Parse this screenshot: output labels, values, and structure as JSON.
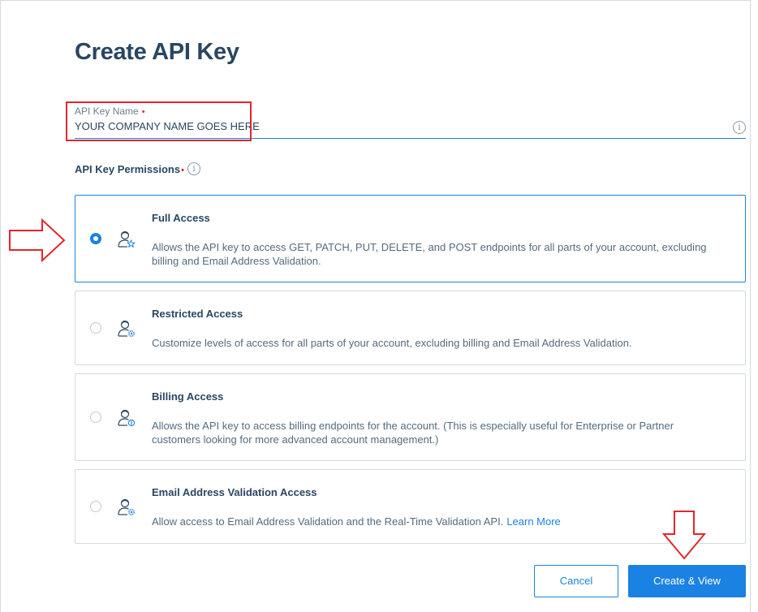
{
  "page": {
    "title": "Create API Key"
  },
  "name_field": {
    "label": "API Key Name",
    "required_mark": "•",
    "value": "YOUR COMPANY NAME GOES HERE",
    "info_glyph": "i"
  },
  "permissions": {
    "label": "API Key Permissions",
    "required_mark": "•",
    "info_glyph": "i",
    "selected": "full",
    "options": [
      {
        "id": "full",
        "title": "Full Access",
        "description": "Allows the API key to access GET, PATCH, PUT, DELETE, and POST endpoints for all parts of your account, excluding billing and Email Address Validation.",
        "icon": "user-star-icon",
        "checked": true
      },
      {
        "id": "restricted",
        "title": "Restricted Access",
        "description": "Customize levels of access for all parts of your account, excluding billing and Email Address Validation.",
        "icon": "user-gear-icon",
        "checked": false
      },
      {
        "id": "billing",
        "title": "Billing Access",
        "description": "Allows the API key to access billing endpoints for the account. (This is especially useful for Enterprise or Partner customers looking for more advanced account management.)",
        "icon": "user-dollar-icon",
        "checked": false
      },
      {
        "id": "email_validation",
        "title": "Email Address Validation Access",
        "description": "Allow access to Email Address Validation and the Real-Time Validation API.",
        "link": "Learn More",
        "icon": "user-gear-icon",
        "checked": false
      }
    ]
  },
  "buttons": {
    "cancel": "Cancel",
    "create": "Create & View"
  },
  "colors": {
    "primary": "#1a82e2",
    "text": "#294661",
    "annotation": "#e2262c",
    "border": "#d4dadf"
  }
}
